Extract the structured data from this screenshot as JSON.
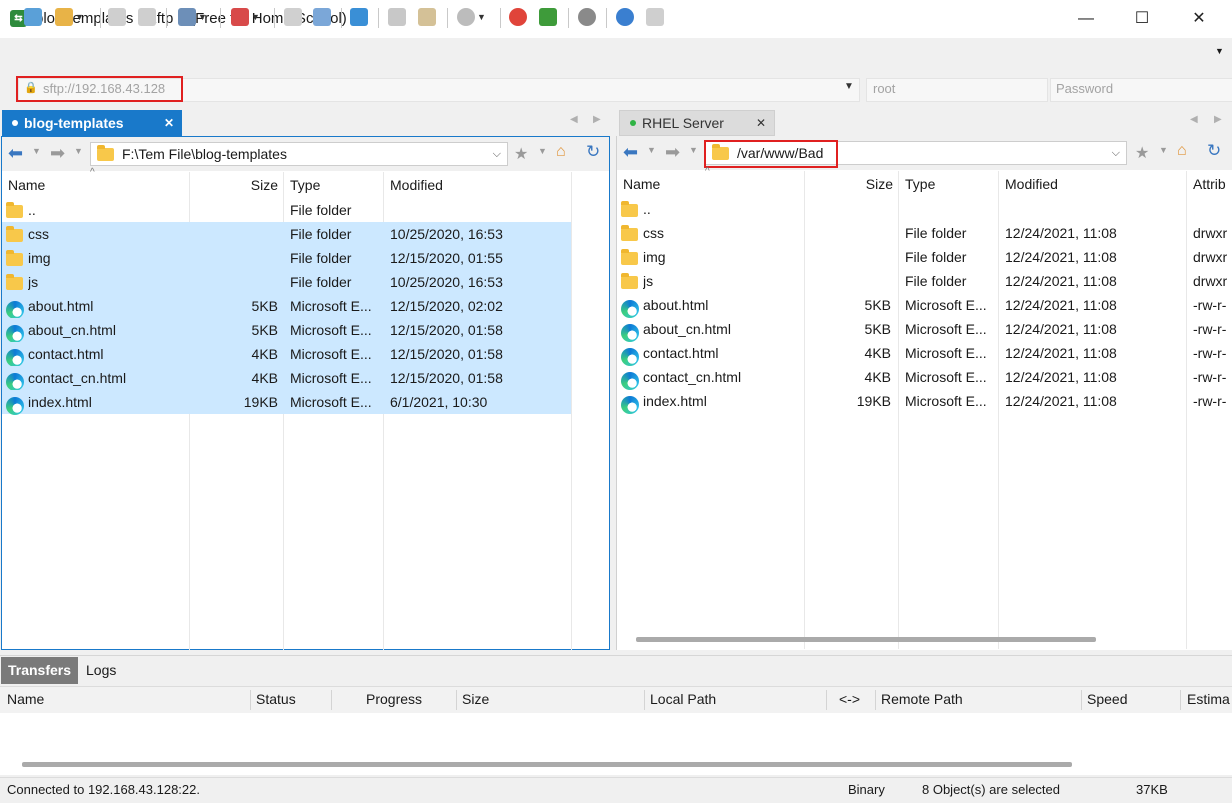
{
  "window": {
    "title": "blog-templates - Xftp 7 (Free for Home/School)",
    "minimize": "—",
    "maximize": "☐",
    "close": "✕"
  },
  "address": {
    "url_placeholder": "sftp://192.168.43.128",
    "user_placeholder": "root",
    "password_placeholder": "Password"
  },
  "left": {
    "tab_label": "blog-templates",
    "path": "F:\\Tem File\\blog-templates",
    "columns": [
      "Name",
      "Size",
      "Type",
      "Modified"
    ],
    "rows": [
      {
        "name": "..",
        "size": "",
        "type": "File folder",
        "modified": "",
        "icon": "folder-icon",
        "selected": false
      },
      {
        "name": "css",
        "size": "",
        "type": "File folder",
        "modified": "10/25/2020, 16:53",
        "icon": "folder-icon",
        "selected": true
      },
      {
        "name": "img",
        "size": "",
        "type": "File folder",
        "modified": "12/15/2020, 01:55",
        "icon": "folder-icon",
        "selected": true
      },
      {
        "name": "js",
        "size": "",
        "type": "File folder",
        "modified": "10/25/2020, 16:53",
        "icon": "folder-icon",
        "selected": true
      },
      {
        "name": "about.html",
        "size": "5KB",
        "type": "Microsoft E...",
        "modified": "12/15/2020, 02:02",
        "icon": "edge-icon",
        "selected": true
      },
      {
        "name": "about_cn.html",
        "size": "5KB",
        "type": "Microsoft E...",
        "modified": "12/15/2020, 01:58",
        "icon": "edge-icon",
        "selected": true
      },
      {
        "name": "contact.html",
        "size": "4KB",
        "type": "Microsoft E...",
        "modified": "12/15/2020, 01:58",
        "icon": "edge-icon",
        "selected": true
      },
      {
        "name": "contact_cn.html",
        "size": "4KB",
        "type": "Microsoft E...",
        "modified": "12/15/2020, 01:58",
        "icon": "edge-icon",
        "selected": true
      },
      {
        "name": "index.html",
        "size": "19KB",
        "type": "Microsoft E...",
        "modified": "6/1/2021, 10:30",
        "icon": "edge-icon",
        "selected": true
      }
    ]
  },
  "right": {
    "tab_label": "RHEL Server",
    "path": "/var/www/Bad",
    "columns": [
      "Name",
      "Size",
      "Type",
      "Modified",
      "Attrib"
    ],
    "rows": [
      {
        "name": "..",
        "size": "",
        "type": "",
        "modified": "",
        "attrib": "",
        "icon": "folder-icon"
      },
      {
        "name": "css",
        "size": "",
        "type": "File folder",
        "modified": "12/24/2021, 11:08",
        "attrib": "drwxr",
        "icon": "folder-icon"
      },
      {
        "name": "img",
        "size": "",
        "type": "File folder",
        "modified": "12/24/2021, 11:08",
        "attrib": "drwxr",
        "icon": "folder-icon"
      },
      {
        "name": "js",
        "size": "",
        "type": "File folder",
        "modified": "12/24/2021, 11:08",
        "attrib": "drwxr",
        "icon": "folder-icon"
      },
      {
        "name": "about.html",
        "size": "5KB",
        "type": "Microsoft E...",
        "modified": "12/24/2021, 11:08",
        "attrib": "-rw-r-",
        "icon": "edge-icon"
      },
      {
        "name": "about_cn.html",
        "size": "5KB",
        "type": "Microsoft E...",
        "modified": "12/24/2021, 11:08",
        "attrib": "-rw-r-",
        "icon": "edge-icon"
      },
      {
        "name": "contact.html",
        "size": "4KB",
        "type": "Microsoft E...",
        "modified": "12/24/2021, 11:08",
        "attrib": "-rw-r-",
        "icon": "edge-icon"
      },
      {
        "name": "contact_cn.html",
        "size": "4KB",
        "type": "Microsoft E...",
        "modified": "12/24/2021, 11:08",
        "attrib": "-rw-r-",
        "icon": "edge-icon"
      },
      {
        "name": "index.html",
        "size": "19KB",
        "type": "Microsoft E...",
        "modified": "12/24/2021, 11:08",
        "attrib": "-rw-r-",
        "icon": "edge-icon"
      }
    ]
  },
  "transfers": {
    "tabs": [
      "Transfers",
      "Logs"
    ],
    "columns": [
      "Name",
      "Status",
      "Progress",
      "Size",
      "Local Path",
      "<->",
      "Remote Path",
      "Speed",
      "Estima"
    ]
  },
  "status": {
    "connection": "Connected to 192.168.43.128:22.",
    "mode": "Binary",
    "selection": "8 Object(s) are selected",
    "size": "37KB"
  },
  "colors": {
    "accent": "#1979ca",
    "selection": "#cce8ff",
    "highlight_box": "#e02020",
    "connected_dot": "#2fb344"
  }
}
